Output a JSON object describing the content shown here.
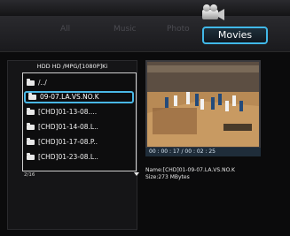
{
  "tabs": [
    {
      "label": "All"
    },
    {
      "label": "Music"
    },
    {
      "label": "Photo"
    },
    {
      "label": "Movies",
      "active": true
    }
  ],
  "browser": {
    "path": "HDD  HD /MPG/[1080P]Ki",
    "items": [
      {
        "label": "/../",
        "selected": false
      },
      {
        "label": "09-07.LA.VS.NO.K",
        "selected": true
      },
      {
        "label": "[CHD]01-13-08....",
        "selected": false
      },
      {
        "label": "[CHD]01-14-08.L..",
        "selected": false
      },
      {
        "label": "[CHD]01-17-08.P..",
        "selected": false
      },
      {
        "label": "[CHD]01-23-08.L..",
        "selected": false
      }
    ],
    "page": "2/16"
  },
  "preview": {
    "time": "00 : 00 : 17 / 00 : 02 : 25"
  },
  "file_info": {
    "name": "Name:[CHD]01-09-07.LA.VS.NO.K",
    "size": "Size:273 MBytes"
  },
  "colors": {
    "accent": "#41b8e8",
    "background": "#0b0b0c"
  }
}
